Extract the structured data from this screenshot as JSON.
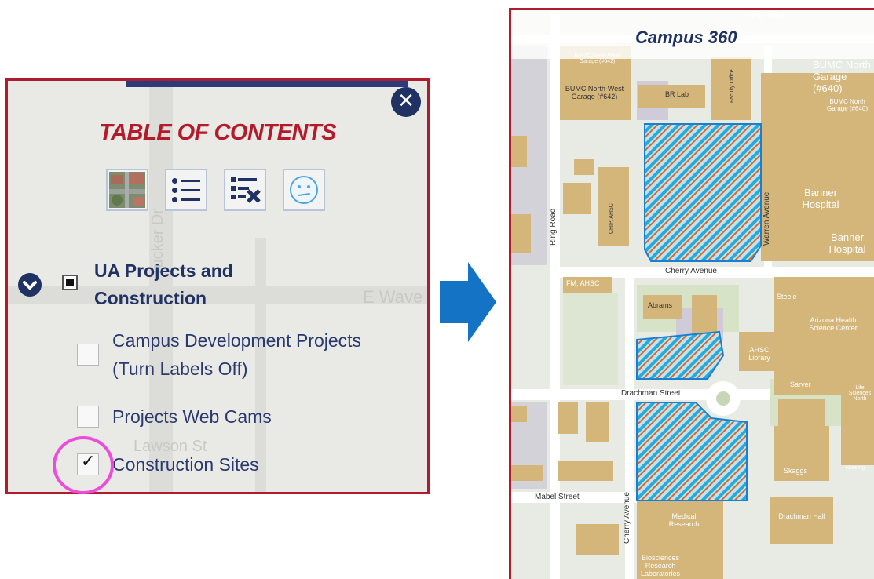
{
  "toc": {
    "title": "TABLE OF CONTENTS",
    "close_glyph": "✕",
    "tools": [
      {
        "name": "basemap-thumbnail-icon"
      },
      {
        "name": "legend-list-icon"
      },
      {
        "name": "layer-remove-icon"
      },
      {
        "name": "feedback-face-icon"
      }
    ],
    "layer_group": {
      "label": "UA Projects and Construction",
      "expanded": true,
      "checked": "partial"
    },
    "sublayers": [
      {
        "label": "Campus Development Projects  (Turn Labels Off)",
        "checked": false
      },
      {
        "label": "Projects Web Cams",
        "checked": false
      },
      {
        "label": "Construction Sites",
        "checked": true
      }
    ],
    "check_glyph": "✓",
    "bg_street_label": "E Wave",
    "bg_street_label_2": "Tucker Dr",
    "bg_street_label_3": "Lawson St",
    "colors": {
      "accent": "#b31b2b",
      "navy": "#1f3263",
      "highlight": "#ee4bd9"
    }
  },
  "map": {
    "title": "Campus 360",
    "streets": {
      "ring_road_top": "Ring Road",
      "ring_road_left": "Ring Road",
      "cherry_avenue": "Cherry Avenue",
      "cherry_avenue_vertical": "Cherry Avenue",
      "drachman_street": "Drachman Street",
      "mabel_street": "Mabel Street",
      "warren_avenue": "Warren Avenue"
    },
    "buildings": {
      "bumc_nw_garage_1": "BUMC North-West Garage (#642)",
      "bumc_nw_garage_2": "BUMC North-West Garage (#642)",
      "bumc_north_garage_1": "BUMC North Garage (#640)",
      "bumc_north_garage_2": "BUMC North Garage (#640)",
      "br_lab": "BR Lab",
      "faculty_office": "Faculty Office",
      "banner_hospital_1": "Banner Hospital",
      "banner_hospital_2": "Banner Hospital",
      "chip_ahsc": "CHIP, AHSC",
      "fm_ahsc": "FM, AHSC",
      "abrams": "Abrams",
      "steele": "Steele",
      "arizona_health": "Arizona Health Science Center",
      "ahsc_library": "AHSC Library",
      "sarver": "Sarver",
      "life_sciences": "Life Sciences North",
      "skaggs": "Skaggs",
      "nursing": "Nursing",
      "medical_research": "Medical Research",
      "drachman_hall": "Drachman Hall",
      "biosciences": "Biosciences Research Laboratories"
    },
    "colors": {
      "building": "#d4b57a",
      "construction_outline": "#1b7fd1",
      "hatch_blue": "#2aa8d8",
      "hatch_orange": "#d9692b"
    }
  }
}
